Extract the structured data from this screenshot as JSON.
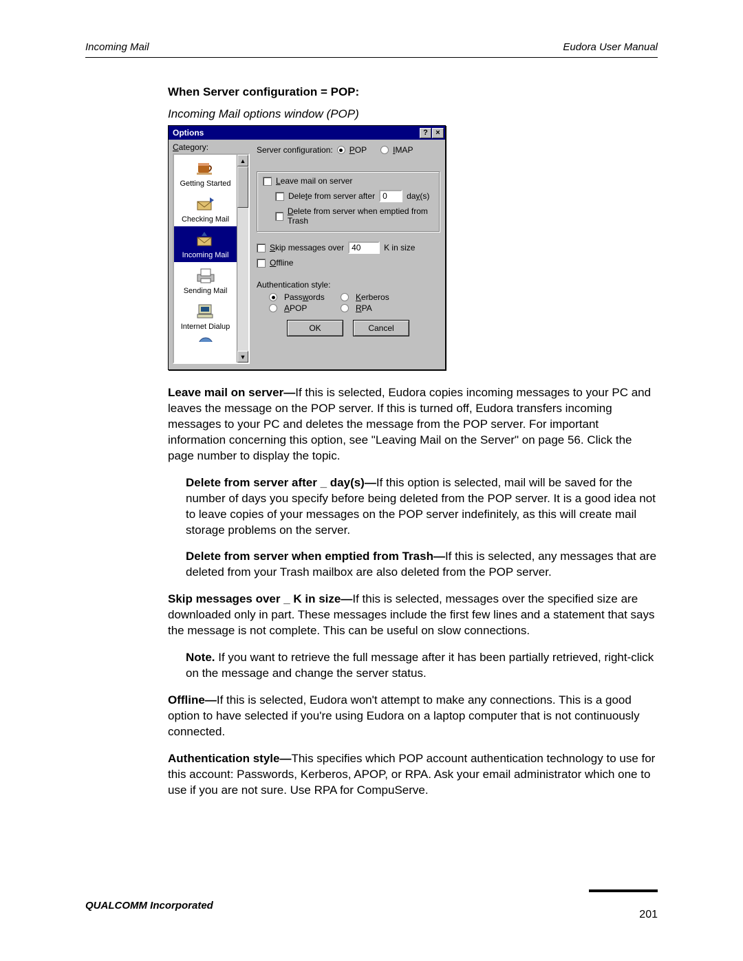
{
  "header": {
    "left": "Incoming Mail",
    "right": "Eudora User Manual"
  },
  "section_title": "When Server configuration = POP:",
  "caption": "Incoming Mail options window (POP)",
  "dialog": {
    "title": "Options",
    "category_label_pre": "C",
    "category_label_post": "ategory:",
    "categories": [
      {
        "label": "Getting Started"
      },
      {
        "label": "Checking Mail"
      },
      {
        "label": "Incoming Mail"
      },
      {
        "label": "Sending Mail"
      },
      {
        "label": "Internet Dialup"
      }
    ],
    "server_config_label": "Server configuration:",
    "pop_pre": "P",
    "pop_post": "OP",
    "imap_pre": "I",
    "imap_post": "MAP",
    "leave_pre": "L",
    "leave_post": "eave mail on server",
    "del_after_pre": "Dele",
    "del_after_u": "t",
    "del_after_post": "e from server after",
    "del_after_value": "0",
    "days_pre": "da",
    "days_u": "y",
    "days_post": "(s)",
    "del_trash_pre": "D",
    "del_trash_post": "elete from server when emptied from Trash",
    "skip_pre": "S",
    "skip_post": "kip messages over",
    "skip_value": "40",
    "k_in_size": "K in size",
    "offline_pre": "O",
    "offline_post": "ffline",
    "auth_label": "Authentication style:",
    "pw_pre": "Pass",
    "pw_u": "w",
    "pw_post": "ords",
    "kerb_pre": "K",
    "kerb_post": "erberos",
    "apop_pre": "A",
    "apop_post": "POP",
    "rpa_pre": "R",
    "rpa_post": "PA",
    "ok": "OK",
    "cancel": "Cancel"
  },
  "body": {
    "p1_b": "Leave mail on server—",
    "p1": "If this is selected, Eudora copies incoming messages to your PC and leaves the message on the POP server. If this is turned off, Eudora transfers incoming messages to your PC and deletes the message from the POP server. For important information concerning this option, see \"Leaving Mail on the Server\" on page 56. Click the page number to display the topic.",
    "p2_b": "Delete from server after _ day(s)—",
    "p2": "If this option is selected, mail will be saved for the number of days you specify before being deleted from the POP server. It is a good idea not to leave copies of your messages on the POP server indefinitely, as this will create mail storage problems on the server.",
    "p3_b": "Delete from server when emptied from Trash—",
    "p3": "If this is selected, any messages that are deleted from your Trash mailbox are also deleted from the POP server.",
    "p4_b": "Skip messages over _ K in size—",
    "p4": "If this is selected, messages over the specified size are downloaded only in part. These messages include the first few lines and a statement that says the message is not complete. This can be useful on slow connections.",
    "p5_b": "Note.",
    "p5": " If you want to retrieve the full message after it has been partially retrieved, right-click on the message and change the server status.",
    "p6_b": "Offline—",
    "p6": "If this is selected, Eudora won't attempt to make any connections. This is a good option to have selected if you're using Eudora on a laptop computer that is not continuously connected.",
    "p7_b": "Authentication style—",
    "p7": "This specifies which POP account authentication technology to use for this account: Passwords, Kerberos, APOP, or RPA. Ask your email administrator which one to use if you are not sure. Use RPA for CompuServe."
  },
  "footer": {
    "company": "QUALCOMM Incorporated",
    "page": "201"
  }
}
